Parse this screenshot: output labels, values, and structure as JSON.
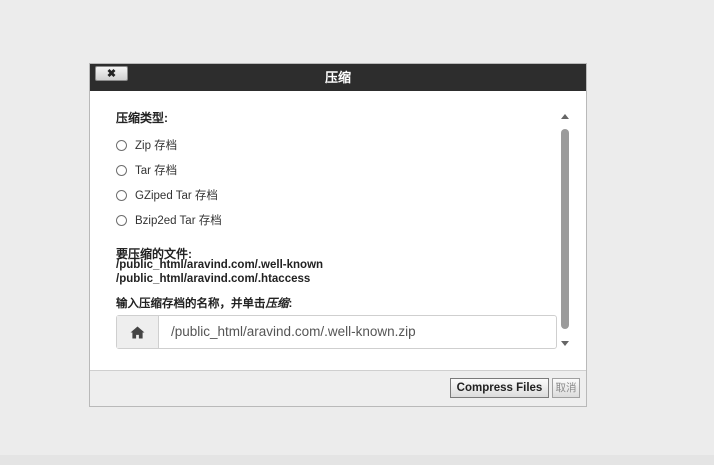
{
  "dialog": {
    "title": "压缩",
    "close_label": "✖"
  },
  "compression_type": {
    "label": "压缩类型:",
    "options": [
      {
        "label": "Zip 存档"
      },
      {
        "label": "Tar 存档"
      },
      {
        "label": "GZiped Tar 存档"
      },
      {
        "label": "Bzip2ed Tar 存档"
      }
    ]
  },
  "files": {
    "label": "要压缩的文件:",
    "items": [
      "/public_html/aravind.com/.well-known",
      "/public_html/aravind.com/.htaccess"
    ]
  },
  "archive_name": {
    "instruction_prefix": "输入压缩存档的名称，并单击",
    "instruction_action": "压缩",
    "instruction_suffix": ":",
    "value": "/public_html/aravind.com/.well-known.zip",
    "addon_icon": "home-icon"
  },
  "footer": {
    "compress_label": "Compress Files",
    "cancel_label": "取消"
  }
}
